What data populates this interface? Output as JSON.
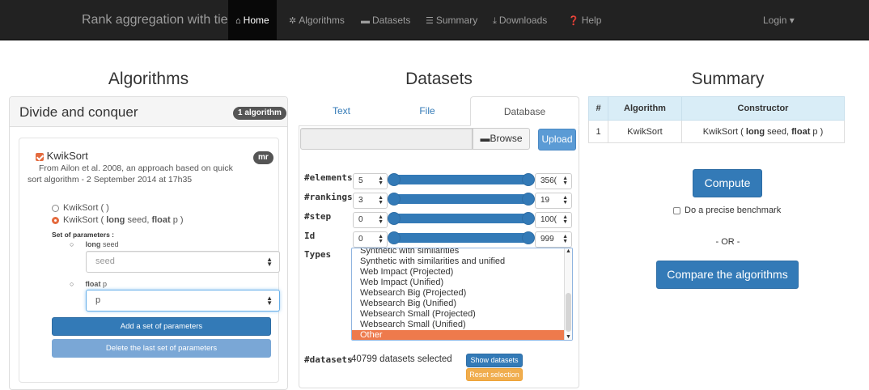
{
  "navbar": {
    "brand": "Rank aggregation with ties",
    "items": [
      {
        "label": "Home",
        "icon": "home-icon"
      },
      {
        "label": "Algorithms",
        "icon": "gear-icon"
      },
      {
        "label": "Datasets",
        "icon": "stack-icon"
      },
      {
        "label": "Summary",
        "icon": "list-icon"
      },
      {
        "label": "Downloads",
        "icon": "download-icon"
      },
      {
        "label": "Help",
        "icon": "question-icon"
      }
    ],
    "login": "Login ▾"
  },
  "algorithms": {
    "heading": "Algorithms",
    "panel_title": "Divide and conquer",
    "panel_badge": "1 algorithm",
    "algo_name": "KwikSort",
    "algo_badge": "mr",
    "description_line1": "From Ailon et al. 2008, an approach based on quick",
    "description_line2": "sort algorithm - 2 September 2014 at 17h35",
    "option1": "KwikSort ( )",
    "option2_prefix": "KwikSort ( ",
    "option2_type1": "long",
    "option2_mid": " seed, ",
    "option2_type2": "float",
    "option2_suffix": " p )",
    "params_label": "Set of parameters :",
    "param1_type": "long",
    "param1_name": " seed",
    "param1_placeholder": "seed",
    "param2_type": "float",
    "param2_name": " p",
    "param2_value": "p",
    "add_button": "Add a set of parameters",
    "delete_button": "Delete the last set of parameters"
  },
  "datasets": {
    "heading": "Datasets",
    "tabs": [
      "Text",
      "File",
      "Database"
    ],
    "browse": "Browse",
    "upload": "Upload",
    "rows": [
      {
        "label": "#elements",
        "min": "5",
        "max": "356(",
        "min_frac": 0.0,
        "max_frac": 1.0
      },
      {
        "label": "#rankings",
        "min": "3",
        "max": "19",
        "min_frac": 0.0,
        "max_frac": 1.0
      },
      {
        "label": "#step",
        "min": "0",
        "max": "100(",
        "min_frac": 0.0,
        "max_frac": 1.0
      },
      {
        "label": "Id",
        "min": "0",
        "max": "999",
        "min_frac": 0.0,
        "max_frac": 1.0
      }
    ],
    "types_label": "Types",
    "types": [
      "Synthetic with similarities",
      "Synthetic with similarities and unified",
      "Web Impact (Projected)",
      "Web Impact (Unified)",
      "Websearch Big (Projected)",
      "Websearch Big (Unified)",
      "Websearch Small (Projected)",
      "Websearch Small (Unified)",
      "Other"
    ],
    "selected_type": "Other",
    "datasets_label": "#datasets",
    "datasets_count": "40799 datasets selected",
    "show_button": "Show datasets",
    "reset_button": "Reset selection"
  },
  "summary": {
    "heading": "Summary",
    "columns": [
      "#",
      "Algorithm",
      "Constructor"
    ],
    "rows": [
      {
        "num": "1",
        "algorithm": "KwikSort",
        "c_prefix": "KwikSort ( ",
        "c_t1": "long",
        "c_mid": " seed, ",
        "c_t2": "float",
        "c_suffix": " p )"
      }
    ],
    "compute": "Compute",
    "benchmark": "Do a precise benchmark",
    "or": "- OR -",
    "compare": "Compare the algorithms"
  },
  "colors": {
    "navbar": "#222222",
    "primary": "#337ab7",
    "accent_orange": "#ee7a4c",
    "table_header": "#d9edf7"
  }
}
